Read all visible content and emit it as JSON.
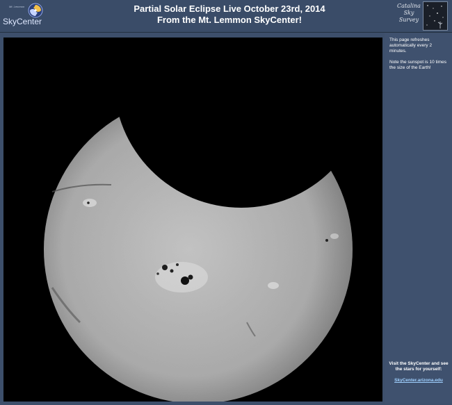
{
  "header": {
    "logo_small": "Mt. Lemmon",
    "logo_name": "SkyCenter",
    "title_line1": "Partial Solar Eclipse Live October 23rd, 2014",
    "title_line2": "From the Mt. Lemmon SkyCenter!",
    "right_logo_line1": "Catalina",
    "right_logo_line2": "Sky",
    "right_logo_line3": "Survey"
  },
  "main": {
    "image_alt": "Partial solar eclipse live image"
  },
  "sidebar": {
    "refresh_note": "This page refreshes automatically every 2 minutes.",
    "sunspot_note": "Note the sunspot is 10 times the size of the Earth!",
    "visit_text": "Visit the SkyCenter and see the stars for yourself:",
    "link_text": "SkyCenter.arizona.edu"
  },
  "colors": {
    "page_bg": "#3d4f6b",
    "link": "#9fd0ff"
  }
}
